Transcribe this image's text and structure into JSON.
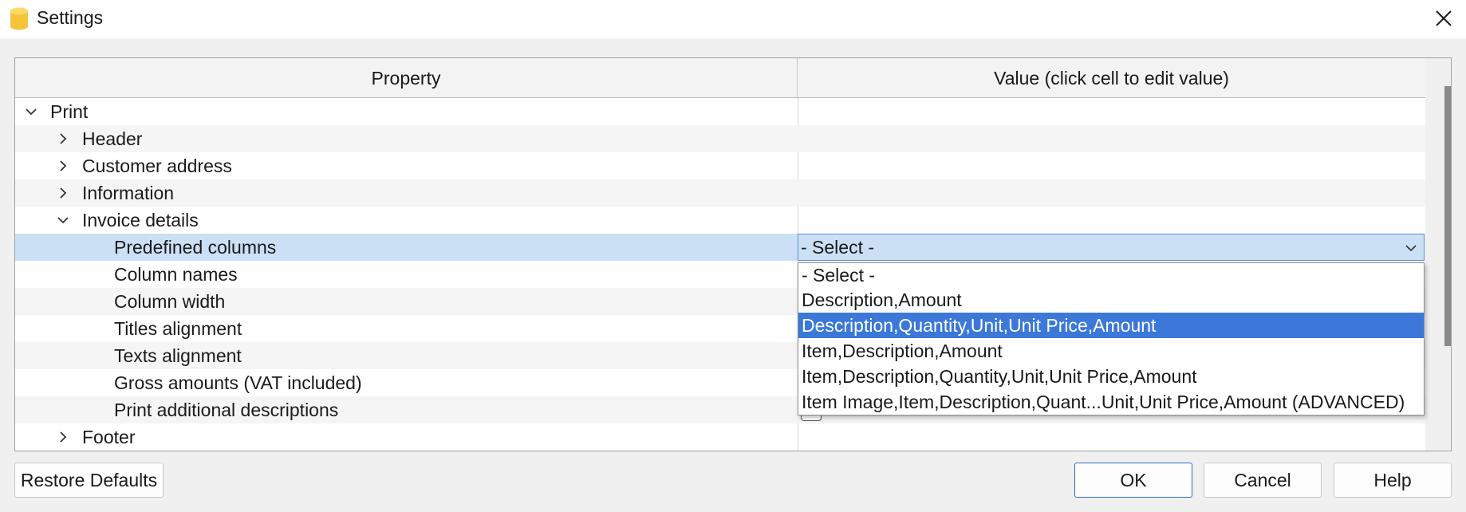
{
  "window": {
    "title": "Settings",
    "app_icon": "app-database-icon",
    "close_icon": "close-icon"
  },
  "table": {
    "headers": {
      "property": "Property",
      "value": "Value (click cell to edit value)"
    },
    "rows": [
      {
        "label": "Print",
        "level": 0,
        "expander": "expanded"
      },
      {
        "label": "Header",
        "level": 1,
        "expander": "collapsed"
      },
      {
        "label": "Customer address",
        "level": 1,
        "expander": "collapsed"
      },
      {
        "label": "Information",
        "level": 1,
        "expander": "collapsed"
      },
      {
        "label": "Invoice details",
        "level": 1,
        "expander": "expanded"
      },
      {
        "label": "Predefined columns",
        "level": 2,
        "expander": "none",
        "selected": true
      },
      {
        "label": "Column names",
        "level": 2,
        "expander": "none"
      },
      {
        "label": "Column width",
        "level": 2,
        "expander": "none"
      },
      {
        "label": "Titles alignment",
        "level": 2,
        "expander": "none"
      },
      {
        "label": "Texts alignment",
        "level": 2,
        "expander": "none"
      },
      {
        "label": "Gross amounts (VAT included)",
        "level": 2,
        "expander": "none"
      },
      {
        "label": "Print additional descriptions",
        "level": 2,
        "expander": "none"
      },
      {
        "label": "Footer",
        "level": 1,
        "expander": "collapsed"
      }
    ]
  },
  "combo": {
    "selected": "- Select -",
    "options": [
      "- Select -",
      "Description,Amount",
      "Description,Quantity,Unit,Unit Price,Amount",
      "Item,Description,Amount",
      "Item,Description,Quantity,Unit,Unit Price,Amount",
      "Item Image,Item,Description,Quant...Unit,Unit Price,Amount (ADVANCED)"
    ],
    "highlighted_index": 2
  },
  "buttons": {
    "restore": "Restore Defaults",
    "ok": "OK",
    "cancel": "Cancel",
    "help": "Help"
  },
  "colors": {
    "selection": "#cce0f5",
    "highlight": "#3b78d8",
    "app_icon": "#f5c43b"
  }
}
